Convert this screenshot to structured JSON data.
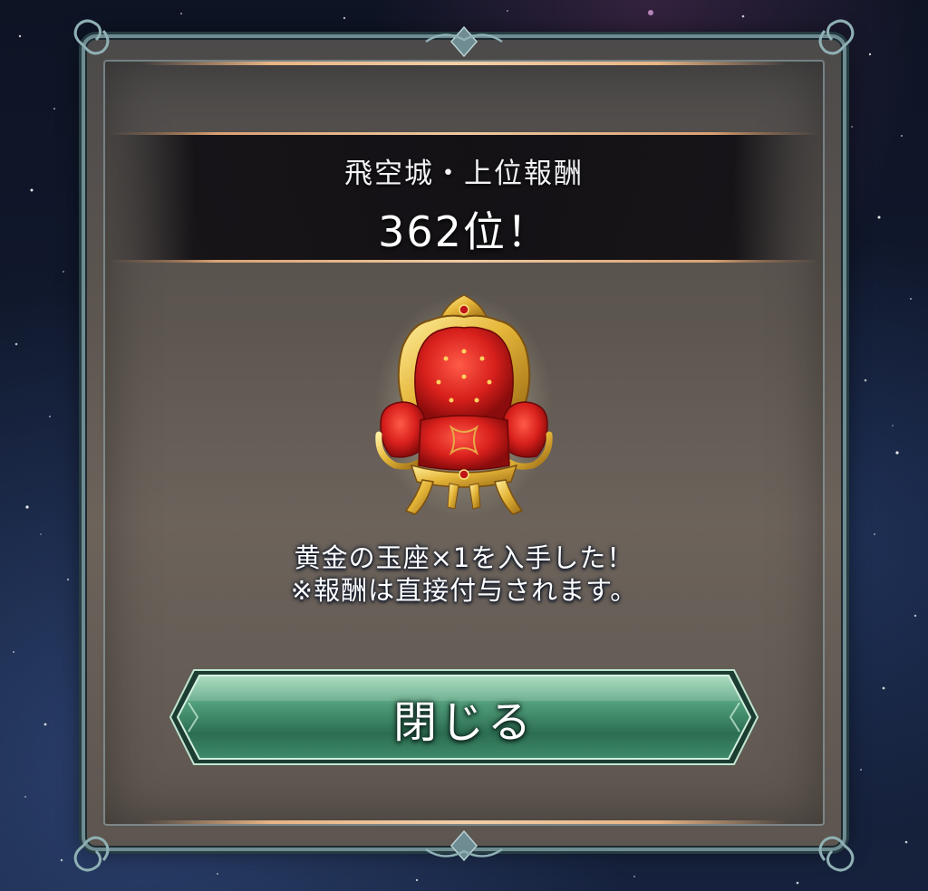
{
  "dialog": {
    "title": "飛空城・上位報酬",
    "rank": "362位！",
    "reward_item_name": "黄金の玉座",
    "reward_message_line1": "黄金の玉座×1を入手した！",
    "reward_message_line2": "※報酬は直接付与されます。",
    "close_label": "閉じる"
  },
  "colors": {
    "panel_bg": "#5d5650",
    "frame_teal": "#6e8c92",
    "accent_copper": "#e8b484",
    "button_green": "#3f8a6a",
    "throne_gold": "#e6b73a",
    "throne_red": "#d8201c"
  },
  "icons": {
    "reward_icon": "golden-throne-icon"
  }
}
